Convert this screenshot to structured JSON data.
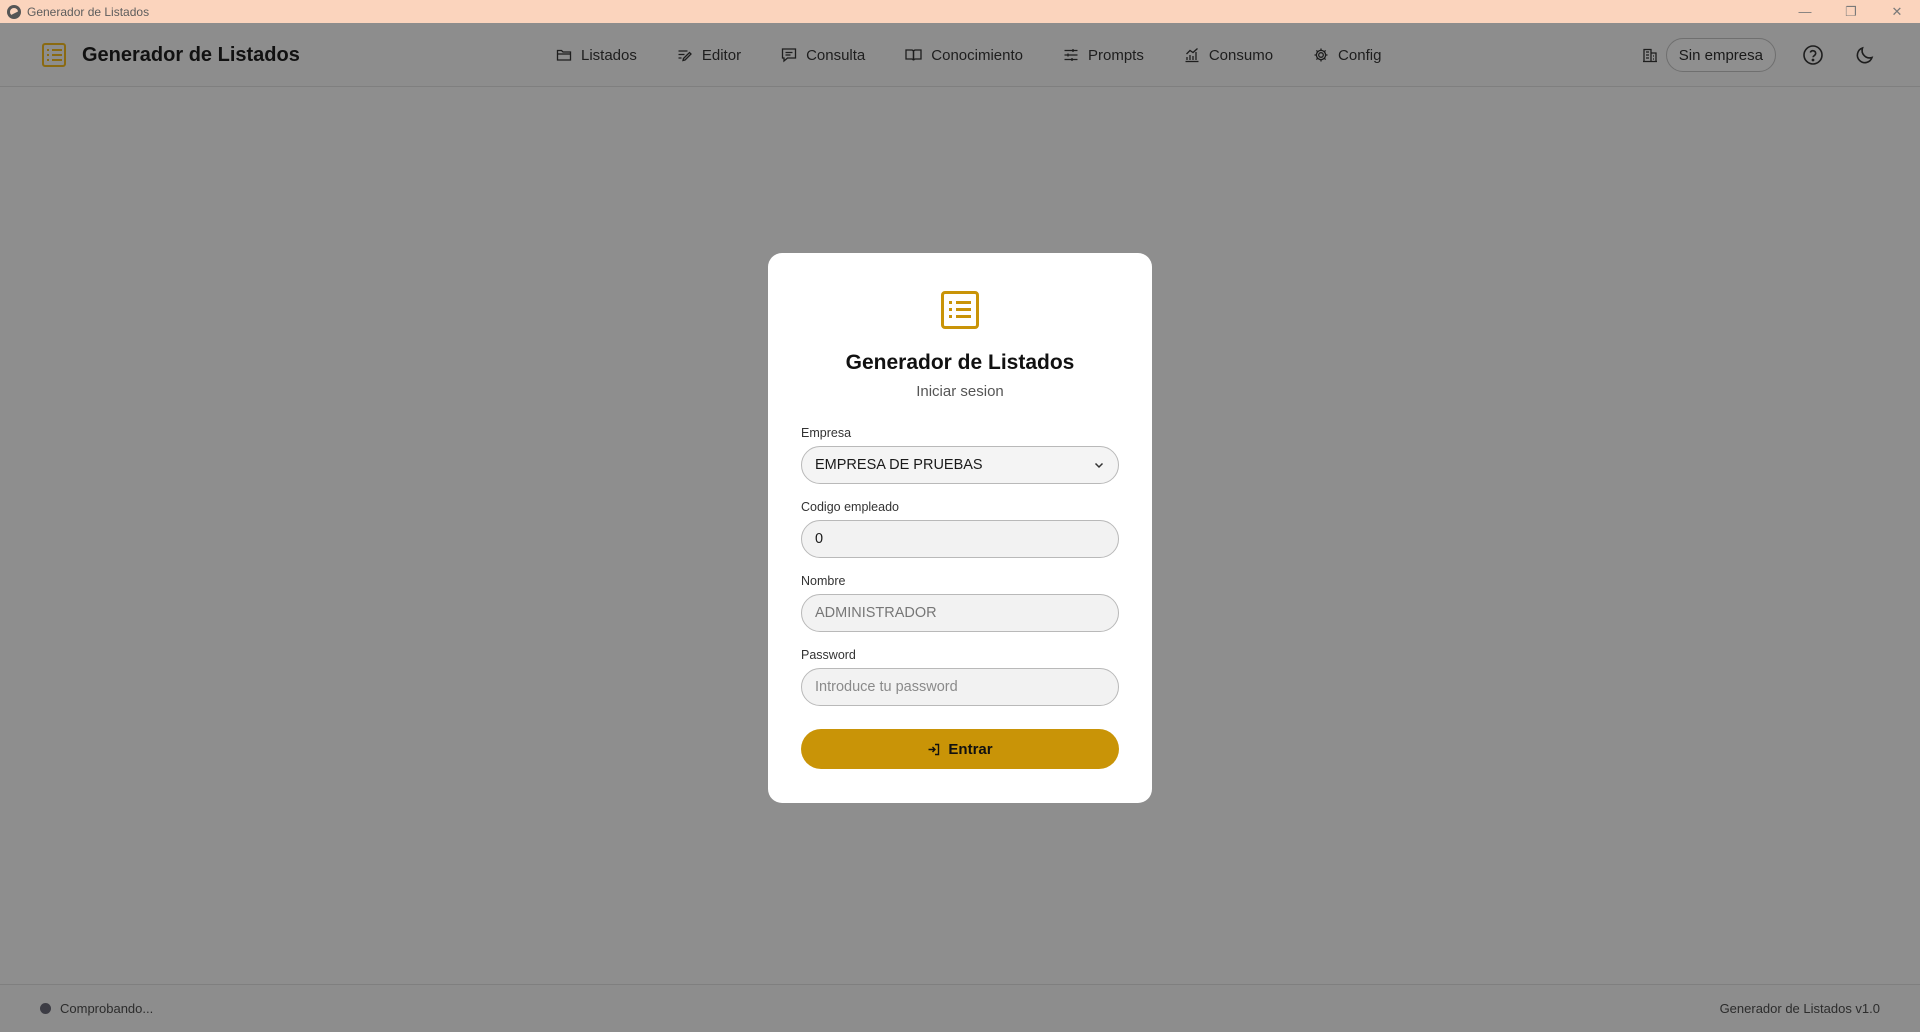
{
  "window": {
    "title": "Generador de Listados",
    "minimize": "—",
    "maximize": "❐",
    "close": "✕"
  },
  "header": {
    "title": "Generador de Listados",
    "nav": [
      "Listados",
      "Editor",
      "Consulta",
      "Conocimiento",
      "Prompts",
      "Consumo",
      "Config"
    ],
    "company_pill": "Sin empresa"
  },
  "login": {
    "title": "Generador de Listados",
    "subtitle": "Iniciar sesion",
    "empresa_label": "Empresa",
    "empresa_value": "EMPRESA DE PRUEBAS",
    "codigo_label": "Codigo empleado",
    "codigo_value": "0",
    "nombre_label": "Nombre",
    "nombre_value": "ADMINISTRADOR",
    "password_label": "Password",
    "password_placeholder": "Introduce tu password",
    "submit_label": "Entrar"
  },
  "footer": {
    "status": "Comprobando...",
    "version": "Generador de Listados v1.0"
  },
  "colors": {
    "accent": "#c99407",
    "overlay": "#8e8e8e",
    "titlebar": "#fbd4bd",
    "card": "#ffffff"
  },
  "icons": [
    "folder-icon",
    "edit-icon",
    "chat-icon",
    "book-icon",
    "sliders-icon",
    "chart-icon",
    "gear-icon",
    "building-icon",
    "help-icon",
    "moon-icon",
    "list-icon",
    "login-icon",
    "chevron-down-icon"
  ]
}
